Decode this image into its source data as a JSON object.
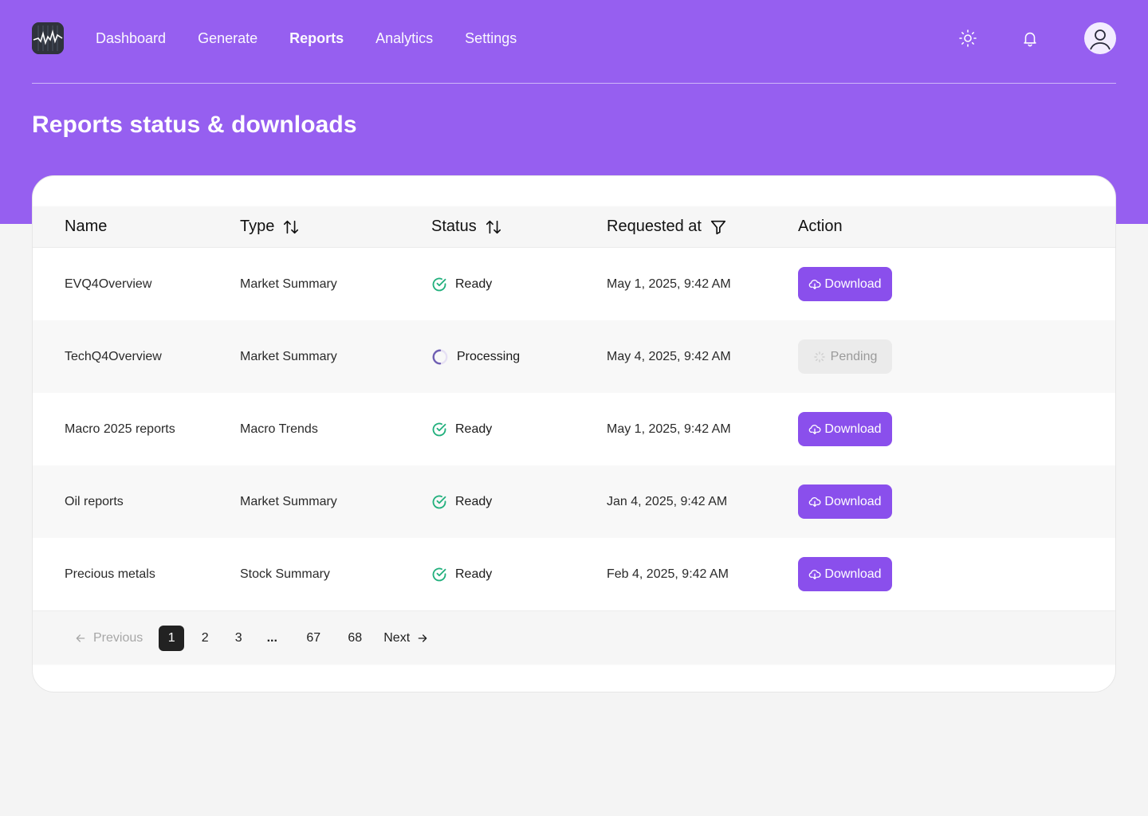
{
  "nav": {
    "items": [
      {
        "label": "Dashboard",
        "active": false
      },
      {
        "label": "Generate",
        "active": false
      },
      {
        "label": "Reports",
        "active": true
      },
      {
        "label": "Analytics",
        "active": false
      },
      {
        "label": "Settings",
        "active": false
      }
    ]
  },
  "icons": {
    "logo": "stock-chart-logo",
    "theme": "sun-icon",
    "notifications": "bell-icon",
    "avatar": "user-avatar-icon"
  },
  "page": {
    "title": "Reports status & downloads"
  },
  "table": {
    "headers": {
      "name": "Name",
      "type": "Type",
      "status": "Status",
      "requested": "Requested at",
      "action": "Action"
    },
    "rows": [
      {
        "name": "EVQ4Overview",
        "type": "Market Summary",
        "status": "Ready",
        "requested": "May 1, 2025, 9:42 AM",
        "action": "Download"
      },
      {
        "name": "TechQ4Overview",
        "type": "Market Summary",
        "status": "Processing",
        "requested": "May 4, 2025, 9:42 AM",
        "action": "Pending"
      },
      {
        "name": "Macro 2025 reports",
        "type": "Macro Trends",
        "status": "Ready",
        "requested": "May 1, 2025, 9:42 AM",
        "action": "Download"
      },
      {
        "name": "Oil reports",
        "type": "Market Summary",
        "status": "Ready",
        "requested": "Jan 4, 2025, 9:42 AM",
        "action": "Download"
      },
      {
        "name": "Precious metals",
        "type": "Stock Summary",
        "status": "Ready",
        "requested": "Feb 4, 2025, 9:42 AM",
        "action": "Download"
      }
    ]
  },
  "pagination": {
    "previous": "Previous",
    "next": "Next",
    "pages": [
      "1",
      "2",
      "3"
    ],
    "ellipsis": "...",
    "last_pages": [
      "67",
      "68"
    ],
    "current": "1"
  },
  "colors": {
    "brand": "#965ff0",
    "button": "#8a4fec",
    "ready": "#22b07d",
    "processing": "#7a66b8"
  }
}
